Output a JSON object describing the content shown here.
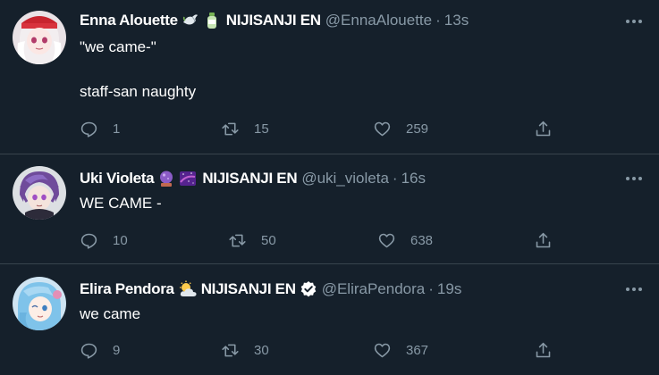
{
  "tweets": [
    {
      "name": "Enna Alouette",
      "emoji_1": "dove-emoji",
      "emoji_2": "bottle-emoji",
      "org": "NIJISANJI EN",
      "handle": "@EnnaAlouette",
      "time": "13s",
      "line_1": "\"we came-\"",
      "line_2": "staff-san naughty",
      "replies": "1",
      "retweets": "15",
      "likes": "259"
    },
    {
      "name": "Uki Violeta",
      "emoji_1": "crystal-ball-emoji",
      "emoji_2": "night-sky-emoji",
      "org": "NIJISANJI EN",
      "handle": "@uki_violeta",
      "time": "16s",
      "line_1": "WE CAME -",
      "replies": "10",
      "retweets": "50",
      "likes": "638"
    },
    {
      "name": "Elira Pendora",
      "emoji_1": "sun-behind-cloud-emoji",
      "org": "NIJISANJI EN",
      "handle": "@EliraPendora",
      "time": "19s",
      "verified": true,
      "line_1": "we came",
      "replies": "9",
      "retweets": "30",
      "likes": "367"
    }
  ],
  "separator": "·",
  "colors": {
    "background": "#15202b",
    "secondary_text": "#8899a6",
    "divider": "#38444d",
    "primary_text": "#ffffff"
  }
}
